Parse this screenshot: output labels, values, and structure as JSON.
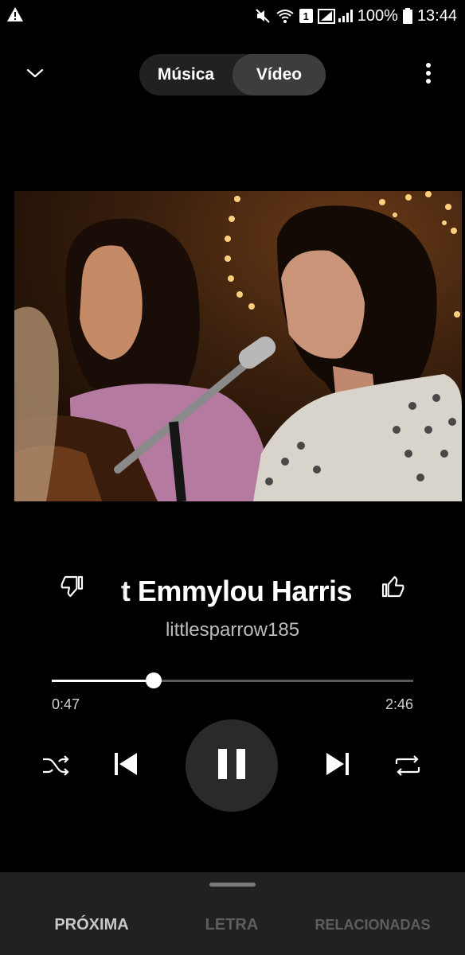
{
  "status_bar": {
    "battery": "100%",
    "time": "13:44",
    "sim_slot": "1"
  },
  "toggle": {
    "music": "Música",
    "video": "Vídeo",
    "selected": "Vídeo"
  },
  "track": {
    "title_visible": "t Emmylou Harris",
    "channel": "littlesparrow185"
  },
  "progress": {
    "current": "0:47",
    "total": "2:46",
    "fraction": 0.283
  },
  "tabs": {
    "next": "PRÓXIMA",
    "lyrics": "LETRA",
    "related": "RELACIONADAS"
  },
  "icons": {
    "status_left": "warning-icon",
    "status_right": [
      "mute-icon",
      "wifi-icon",
      "sim-icon",
      "signal-icon",
      "battery-icon"
    ],
    "collapse": "chevron-down-icon",
    "menu": "more-vert-icon",
    "dislike": "thumb-down-icon",
    "like": "thumb-up-icon",
    "shuffle": "shuffle-icon",
    "previous": "skip-previous-icon",
    "play_pause": "pause-icon",
    "next": "skip-next-icon",
    "repeat": "repeat-icon"
  },
  "colors": {
    "background": "#000000",
    "sheet": "#212121",
    "toggle_bg": "#212121",
    "toggle_selected": "#3d3d3d",
    "progress_played": "#ffffff",
    "progress_remaining": "#5a5a5a"
  }
}
